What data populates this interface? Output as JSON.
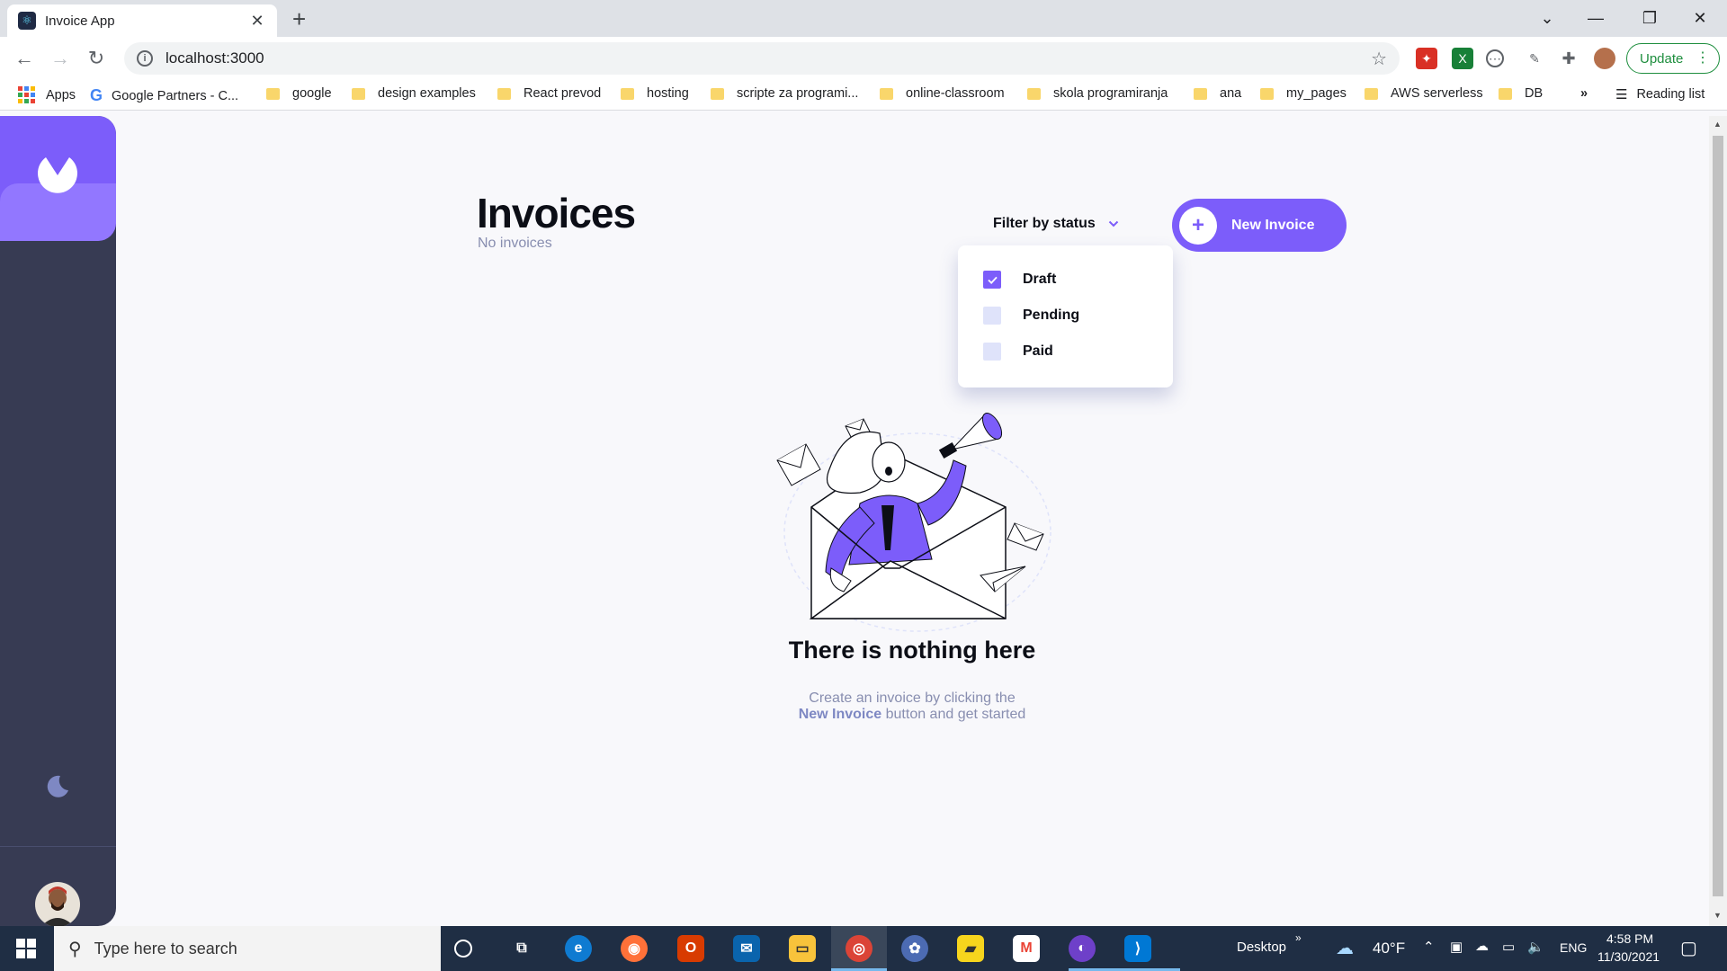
{
  "browser": {
    "tab_title": "Invoice App",
    "url": "localhost:3000",
    "update_label": "Update",
    "bookmarks": [
      "Apps",
      "Google Partners - C...",
      "google",
      "design examples",
      "React prevod",
      "hosting",
      "scripte za programi...",
      "online-classroom",
      "skola programiranja",
      "ana",
      "my_pages",
      "AWS serverless",
      "DB"
    ],
    "bookmarks_overflow": "»",
    "reading_list": "Reading list"
  },
  "app": {
    "title": "Invoices",
    "subtitle": "No invoices",
    "filter_label": "Filter by status",
    "filter_options": [
      {
        "label": "Draft",
        "checked": true
      },
      {
        "label": "Pending",
        "checked": false
      },
      {
        "label": "Paid",
        "checked": false
      }
    ],
    "new_invoice_label": "New Invoice",
    "empty_title": "There is nothing here",
    "empty_text_line1": "Create an invoice by clicking the",
    "empty_text_bold": "New Invoice",
    "empty_text_line2_rest": "button and get started",
    "colors": {
      "accent": "#7c5dfa",
      "accent_light": "#9277ff",
      "sidebar": "#373b53",
      "text": "#0c0e16",
      "muted": "#888eb0"
    }
  },
  "taskbar": {
    "search_placeholder": "Type here to search",
    "desktop_label": "Desktop",
    "weather": "40°F",
    "language": "ENG",
    "time": "4:58 PM",
    "date": "11/30/2021"
  }
}
